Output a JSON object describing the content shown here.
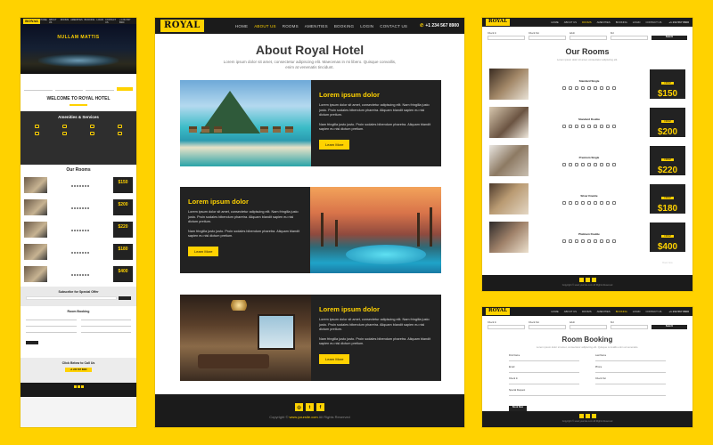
{
  "brand": "ROYAL",
  "colors": {
    "accent": "#FFD200",
    "dark": "#1b1b1b",
    "panel_dark": "#222222"
  },
  "left": {
    "nav_links": [
      "HOME",
      "ABOUT US",
      "ROOMS",
      "AMENITIES",
      "BOOKING",
      "LOGIN",
      "CONTACT US"
    ],
    "phone": "+1 234 567 8900",
    "hero_title": "NULLAM MATTIS",
    "welcome_title": "WELCOME TO ROYAL HOTEL",
    "amenities_title": "Amenities & Services",
    "rooms_title": "Our Rooms",
    "room_prices": [
      "$150",
      "$200",
      "$220",
      "$180",
      "$400"
    ],
    "subscribe_title": "Subscribe for Special Offer",
    "booking_title": "Room Booking",
    "call_title": "Click Below to Call Us",
    "call_phone": "+1 234 567 8900"
  },
  "center": {
    "nav_links": [
      "HOME",
      "ABOUT US",
      "ROOMS",
      "AMENITIES",
      "BOOKING",
      "LOGIN",
      "CONTACT US"
    ],
    "active_link": "ABOUT US",
    "phone": "+1 234 567 8900",
    "phone_icon": "phone-icon",
    "about_title": "About Royal Hotel",
    "about_text": "Lorem ipsum dolor sit amet, consectetur adipiscing elit. Maecenas in mi libero. Quisque convallis, enim at venenatis tincidunt.",
    "cards": [
      {
        "title": "Lorem ipsum dolor",
        "p1": "Lorem ipsum dolor sit amet, consectetur adipiscing elit. Nam fringilla justo justo. Proin sodales bibendum pharetra. Aliquam blandit sapien eu nisl dictum pretium.",
        "p2": "Nam fringilla justo justo. Proin sodales bibendum pharetra. Aliquam blandit sapien eu nisl dictum pretium.",
        "button": "Learn More"
      },
      {
        "title": "Lorem ipsum dolor",
        "p1": "Lorem ipsum dolor sit amet, consectetur adipiscing elit. Nam fringilla justo justo. Proin sodales bibendum pharetra. Aliquam blandit sapien eu nisl dictum pretium.",
        "p2": "Nam fringilla justo justo. Proin sodales bibendum pharetra. Aliquam blandit sapien eu nisl dictum pretium.",
        "button": "Learn More"
      },
      {
        "title": "Lorem ipsum dolor",
        "p1": "Lorem ipsum dolor sit amet, consectetur adipiscing elit. Nam fringilla justo justo. Proin sodales bibendum pharetra. Aliquam blandit sapien eu nisl dictum pretium.",
        "p2": "Nam fringilla justo justo. Proin sodales bibendum pharetra. Aliquam blandit sapien eu nisl dictum pretium.",
        "button": "Learn More"
      }
    ],
    "social_icons": [
      "instagram-icon",
      "twitter-icon",
      "facebook-icon"
    ],
    "copyright_prefix": "Copyright ©",
    "copyright_site": "www.yoursite.com",
    "copyright_suffix": "All Rights Reserved"
  },
  "right_top": {
    "search_labels": [
      "Check In",
      "Check Out",
      "Adult",
      "Kid"
    ],
    "search_button": "Search",
    "title": "Our Rooms",
    "subtitle": "Lorem ipsum dolor sit amet, consectetur adipiscing elit.",
    "rooms": [
      {
        "name": "Standard Single",
        "price": "$150"
      },
      {
        "name": "Standard Double",
        "price": "$200"
      },
      {
        "name": "Premium Single",
        "price": "$220"
      },
      {
        "name": "Silver Double",
        "price": "$180"
      },
      {
        "name": "Platinum Double",
        "price": "$400"
      }
    ],
    "price_from": "FROM",
    "book_label": "Book Now",
    "copyright": "Copyright © www.yoursite.com All Rights Reserved"
  },
  "right_bottom": {
    "title": "Room Booking",
    "subtitle": "Lorem ipsum dolor sit amet, consectetur adipiscing elit. Quisque convallis enim at venenatis.",
    "fields": [
      "First Name",
      "Last Name",
      "Email",
      "Phone",
      "Check In",
      "Check Out",
      "Special Request"
    ],
    "button": "Book Now",
    "copyright": "Copyright © www.yoursite.com All Rights Reserved"
  }
}
